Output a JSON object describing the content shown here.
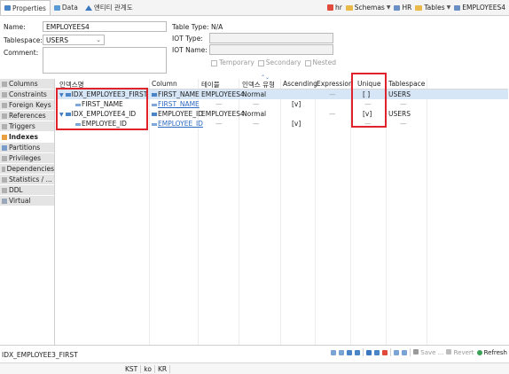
{
  "tabs": [
    {
      "label": "Properties",
      "icon": "properties-icon",
      "active": true
    },
    {
      "label": "Data",
      "icon": "data-icon",
      "active": false
    },
    {
      "label": "엔티티 관계도",
      "icon": "er-diagram-icon",
      "active": false
    }
  ],
  "breadcrumbs": {
    "connection": "hr",
    "schemas": "Schemas",
    "schema": "HR",
    "tables": "Tables",
    "table": "EMPLOYEES4"
  },
  "form": {
    "name_label": "Name:",
    "name_value": "EMPLOYEES4",
    "tablespace_label": "Tablespace:",
    "tablespace_value": "USERS",
    "comment_label": "Comment:",
    "comment_value": "",
    "table_type_label": "Table Type:",
    "table_type_value": "N/A",
    "iot_type_label": "IOT Type:",
    "iot_type_value": "",
    "iot_name_label": "IOT Name:",
    "iot_name_value": "",
    "temporary_label": "Temporary",
    "secondary_label": "Secondary",
    "nested_label": "Nested"
  },
  "sidebar": {
    "items": [
      {
        "label": "Columns",
        "icon": "columns-icon"
      },
      {
        "label": "Constraints",
        "icon": "constraints-icon"
      },
      {
        "label": "Foreign Keys",
        "icon": "foreign-keys-icon"
      },
      {
        "label": "References",
        "icon": "references-icon"
      },
      {
        "label": "Triggers",
        "icon": "triggers-icon"
      },
      {
        "label": "Indexes",
        "icon": "indexes-icon",
        "active": true
      },
      {
        "label": "Partitions",
        "icon": "partitions-icon"
      },
      {
        "label": "Privileges",
        "icon": "privileges-icon"
      },
      {
        "label": "Dependencies",
        "icon": "dependencies-icon"
      },
      {
        "label": "Statistics / ...",
        "icon": "statistics-icon"
      },
      {
        "label": "DDL",
        "icon": "ddl-icon"
      },
      {
        "label": "Virtual",
        "icon": "virtual-icon"
      }
    ]
  },
  "grid": {
    "headers": [
      "인덱스명",
      "Column",
      "테이블",
      "인덱스 유형",
      "Ascending",
      "Expression",
      "Unique",
      "Tablespace"
    ],
    "rows": [
      {
        "name": "IDX_EMPLOYEE3_FIRST",
        "column": "FIRST_NAME",
        "table": "EMPLOYEES4",
        "type": "Normal",
        "ascending": "",
        "expression": "—",
        "unique": "[ ]",
        "tablespace": "USERS",
        "level": 0,
        "selected": true
      },
      {
        "name": "FIRST_NAME",
        "column": "FIRST_NAME",
        "table": "—",
        "type": "—",
        "ascending": "[v]",
        "expression": "",
        "unique": "—",
        "tablespace": "—",
        "level": 1,
        "selected": false
      },
      {
        "name": "IDX_EMPLOYEE4_ID",
        "column": "EMPLOYEE_ID",
        "table": "EMPLOYEES4",
        "type": "Normal",
        "ascending": "",
        "expression": "—",
        "unique": "[v]",
        "tablespace": "USERS",
        "level": 0,
        "selected": false
      },
      {
        "name": "EMPLOYEE_ID",
        "column": "EMPLOYEE_ID",
        "table": "—",
        "type": "—",
        "ascending": "[v]",
        "expression": "",
        "unique": "—",
        "tablespace": "—",
        "level": 1,
        "selected": false
      }
    ]
  },
  "status": {
    "selected_item": "IDX_EMPLOYEE3_FIRST",
    "save_label": "Save ...",
    "revert_label": "Revert",
    "refresh_label": "Refresh",
    "locale": [
      "KST",
      "ko",
      "KR"
    ]
  },
  "colors": {
    "highlight": "#e0232b",
    "selection": "#d6e6f7",
    "link": "#2c6ac2"
  }
}
